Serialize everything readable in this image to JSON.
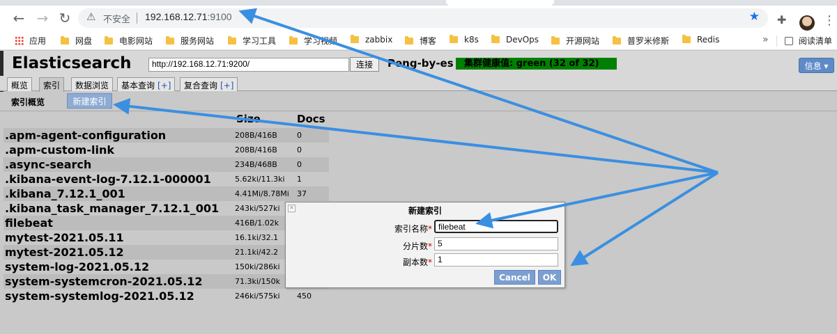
{
  "browser": {
    "insecure_label": "不安全",
    "url_host": "192.168.12.71",
    "url_port": ":9100",
    "bookmarks": [
      "应用",
      "网盘",
      "电影网站",
      "服务网站",
      "学习工具",
      "学习视频",
      "zabbix",
      "博客",
      "k8s",
      "DevOps",
      "开源网站",
      "普罗米修斯",
      "Redis"
    ],
    "more_label": "»",
    "reading_list": "阅读清单"
  },
  "app": {
    "title": "Elasticsearch",
    "cluster_url": "http://192.168.12.71:9200/",
    "connect_label": "连接",
    "cluster_name": "Peng-by-es",
    "health": "集群健康值: green (32 of 32)",
    "info_label": "信息 ▾",
    "tabs": [
      "概览",
      "索引",
      "数据浏览",
      "基本查询",
      "复合查询"
    ],
    "tab_plus": "[+]",
    "subbar_title": "索引概览",
    "new_index_label": "新建索引",
    "col_size": "Size",
    "col_docs": "Docs"
  },
  "indices": [
    {
      "name": ".apm-agent-configuration",
      "size": "208B/416B",
      "docs": "0"
    },
    {
      "name": ".apm-custom-link",
      "size": "208B/416B",
      "docs": "0"
    },
    {
      "name": ".async-search",
      "size": "234B/468B",
      "docs": "0"
    },
    {
      "name": ".kibana-event-log-7.12.1-000001",
      "size": "5.62ki/11.3ki",
      "docs": "1"
    },
    {
      "name": ".kibana_7.12.1_001",
      "size": "4.41Mi/8.78Mi",
      "docs": "37"
    },
    {
      "name": ".kibana_task_manager_7.12.1_001",
      "size": "243ki/527ki",
      "docs": ""
    },
    {
      "name": "filebeat",
      "size": "416B/1.02k",
      "docs": ""
    },
    {
      "name": "mytest-2021.05.11",
      "size": "16.1ki/32.1",
      "docs": ""
    },
    {
      "name": "mytest-2021.05.12",
      "size": "21.1ki/42.2",
      "docs": ""
    },
    {
      "name": "system-log-2021.05.12",
      "size": "150ki/286ki",
      "docs": ""
    },
    {
      "name": "system-systemcron-2021.05.12",
      "size": "71.3ki/150k",
      "docs": ""
    },
    {
      "name": "system-systemlog-2021.05.12",
      "size": "246ki/575ki",
      "docs": "450"
    }
  ],
  "dialog": {
    "title": "新建索引",
    "close_glyph": "×",
    "name_label": "索引名称",
    "name_value": "filebeat",
    "shards_label": "分片数",
    "shards_value": "5",
    "replicas_label": "副本数",
    "replicas_value": "1",
    "required_mark": "*",
    "cancel_label": "Cancel",
    "ok_label": "OK"
  },
  "colors": {
    "arrow": "#3b8fe0",
    "health_green": "#008000",
    "button_blue": "#7b9fd0"
  }
}
